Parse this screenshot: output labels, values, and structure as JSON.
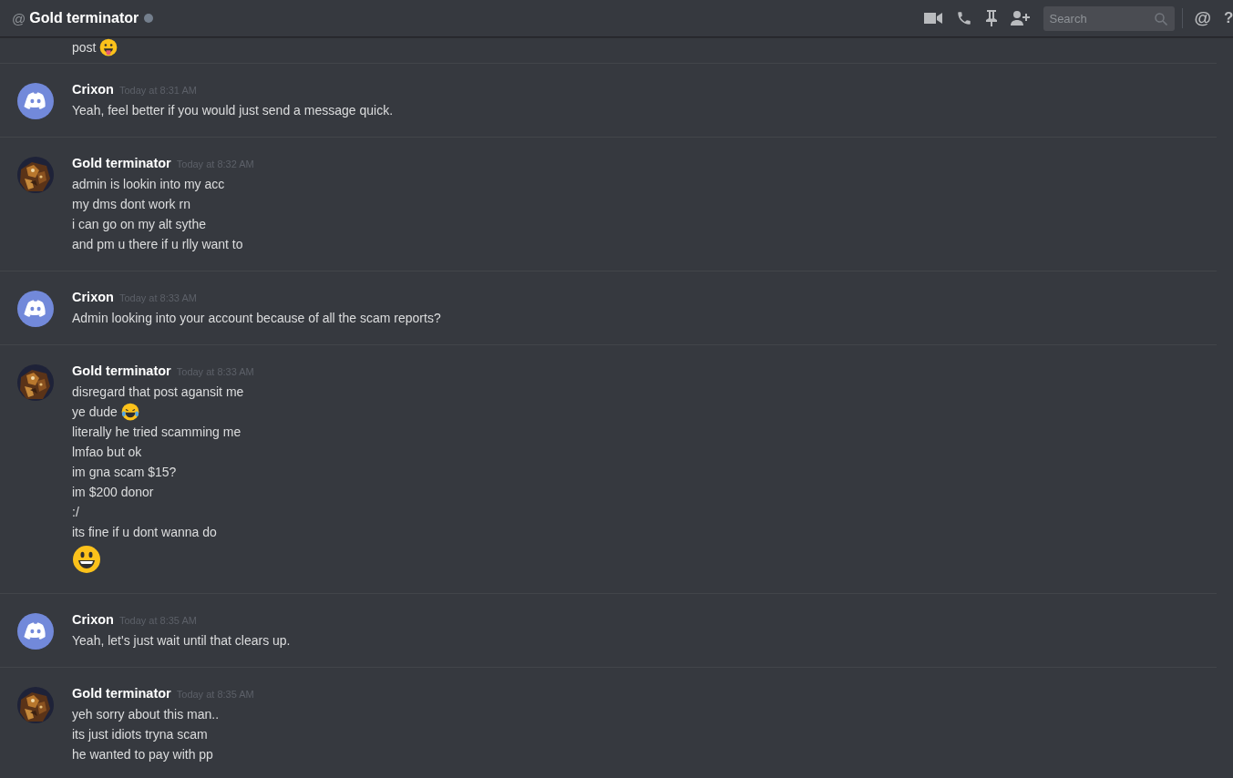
{
  "header": {
    "prefix": "@",
    "title": "Gold terminator",
    "online": false,
    "search": {
      "placeholder": "Search"
    },
    "mentions": "@",
    "help": "?"
  },
  "messages": [
    {
      "continued": true,
      "lines": [
        {
          "text": "post",
          "kind": "tongue"
        }
      ]
    },
    {
      "author": "Crixon",
      "timestamp": "Today at 8:31 AM",
      "kind": "default",
      "lines": [
        {
          "text": "Yeah, feel better if you would just send a message quick.",
          "kind": "plain"
        }
      ]
    },
    {
      "author": "Gold terminator",
      "timestamp": "Today at 8:32 AM",
      "kind": "picture",
      "lines": [
        {
          "text": "admin is lookin into my acc",
          "kind": "plain"
        },
        {
          "text": "my dms dont work rn",
          "kind": "plain"
        },
        {
          "text": "i can go on my alt sythe",
          "kind": "plain"
        },
        {
          "text": "and pm u there if u rlly want to",
          "kind": "plain"
        }
      ]
    },
    {
      "author": "Crixon",
      "timestamp": "Today at 8:33 AM",
      "kind": "default",
      "lines": [
        {
          "text": "Admin looking into your account because of all the scam reports?",
          "kind": "plain"
        }
      ]
    },
    {
      "author": "Gold terminator",
      "timestamp": "Today at 8:33 AM",
      "kind": "picture",
      "lines": [
        {
          "text": "disregard that post agansit me",
          "kind": "plain"
        },
        {
          "text": "ye dude",
          "kind": "joy"
        },
        {
          "text": "literally he tried scamming me",
          "kind": "plain"
        },
        {
          "text": "lmfao but ok",
          "kind": "plain"
        },
        {
          "text": "im gna scam $15?",
          "kind": "plain"
        },
        {
          "text": "im $200 donor",
          "kind": "plain"
        },
        {
          "text": ":/",
          "kind": "plain"
        },
        {
          "text": "its fine if u dont wanna do",
          "kind": "plain"
        },
        {
          "kind": "smile",
          "big": true
        }
      ]
    },
    {
      "author": "Crixon",
      "timestamp": "Today at 8:35 AM",
      "kind": "default",
      "lines": [
        {
          "text": "Yeah, let's just wait until that clears up.",
          "kind": "plain"
        }
      ]
    },
    {
      "author": "Gold terminator",
      "timestamp": "Today at 8:35 AM",
      "kind": "picture",
      "lines": [
        {
          "text": "yeh sorry about this man..",
          "kind": "plain"
        },
        {
          "text": "its just idiots tryna scam",
          "kind": "plain"
        },
        {
          "text": "he wanted to pay with pp",
          "kind": "plain"
        }
      ]
    }
  ]
}
